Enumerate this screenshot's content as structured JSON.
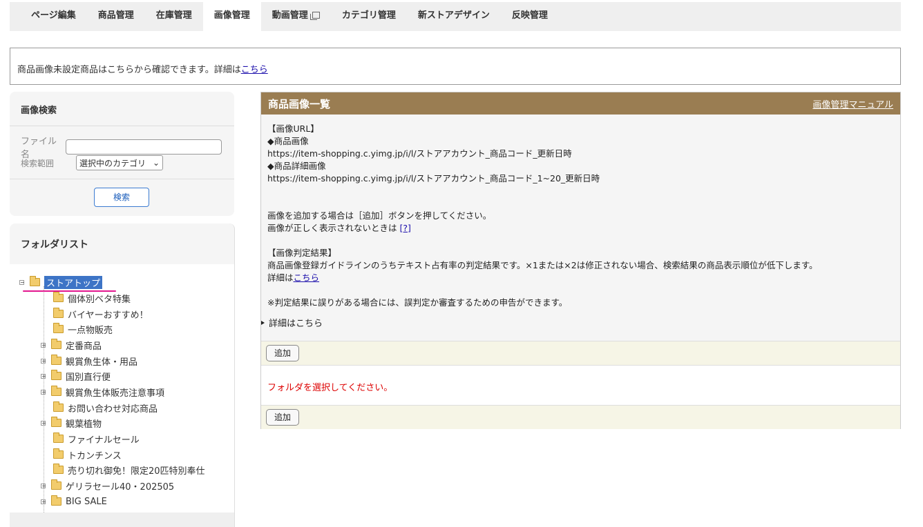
{
  "tabs": [
    {
      "label": "ページ編集"
    },
    {
      "label": "商品管理"
    },
    {
      "label": "在庫管理"
    },
    {
      "label": "画像管理"
    },
    {
      "label": "動画管理"
    },
    {
      "label": "カテゴリ管理"
    },
    {
      "label": "新ストアデザイン"
    },
    {
      "label": "反映管理"
    }
  ],
  "active_tab": "画像管理",
  "notice": {
    "text": "商品画像未設定商品はこちらから確認できます。詳細は",
    "link": "こちら"
  },
  "search": {
    "title": "画像検索",
    "file_label": "ファイル名",
    "range_label": "検索範囲",
    "range_value": "選択中のカテゴリ",
    "button": "検索"
  },
  "folders": {
    "title": "フォルダリスト",
    "root": "ストアトップ",
    "items": [
      {
        "label": "個体別ベタ特集",
        "expandable": false
      },
      {
        "label": "バイヤーおすすめ！",
        "expandable": false
      },
      {
        "label": "一点物販売",
        "expandable": false
      },
      {
        "label": "定番商品",
        "expandable": true
      },
      {
        "label": "観賞魚生体・用品",
        "expandable": true
      },
      {
        "label": "国別直行便",
        "expandable": true
      },
      {
        "label": "観賞魚生体販売注意事項",
        "expandable": true
      },
      {
        "label": "お問い合わせ対応商品",
        "expandable": false
      },
      {
        "label": "観葉植物",
        "expandable": true
      },
      {
        "label": "ファイナルセール",
        "expandable": false
      },
      {
        "label": "トカンチンス",
        "expandable": false
      },
      {
        "label": "売り切れ御免！限定20匹特別奉仕",
        "expandable": false
      },
      {
        "label": "ゲリラセール40・202505",
        "expandable": true
      },
      {
        "label": "BIG SALE",
        "expandable": true
      }
    ]
  },
  "main": {
    "title": "商品画像一覧",
    "manual_link": "画像管理マニュアル",
    "url_heading": "【画像URL】",
    "product_image_label": "◆商品画像",
    "product_image_url": "https://item-shopping.c.yimg.jp/i/l/ストアアカウント_商品コード_更新日時",
    "detail_image_label": "◆商品詳細画像",
    "detail_image_url": "https://item-shopping.c.yimg.jp/i/l/ストアアカウント_商品コード_1~20_更新日時",
    "add_instruction": "画像を追加する場合は［追加］ボタンを押してください。",
    "display_issue": "画像が正しく表示されないときは",
    "help_link": "[?]",
    "judgement_heading": "【画像判定結果】",
    "judgement_text": "商品画像登録ガイドラインのうちテキスト占有率の判定結果です。×1または×2は修正されない場合、検索結果の商品表示順位が低下します。",
    "detail_prefix": "詳細は",
    "detail_link": "こちら",
    "report_note": "※判定結果に誤りがある場合には、誤判定か審査するための申告ができます。",
    "details_toggle": "詳細はこちら",
    "add_button": "追加",
    "select_folder_msg": "フォルダを選択してください。"
  }
}
